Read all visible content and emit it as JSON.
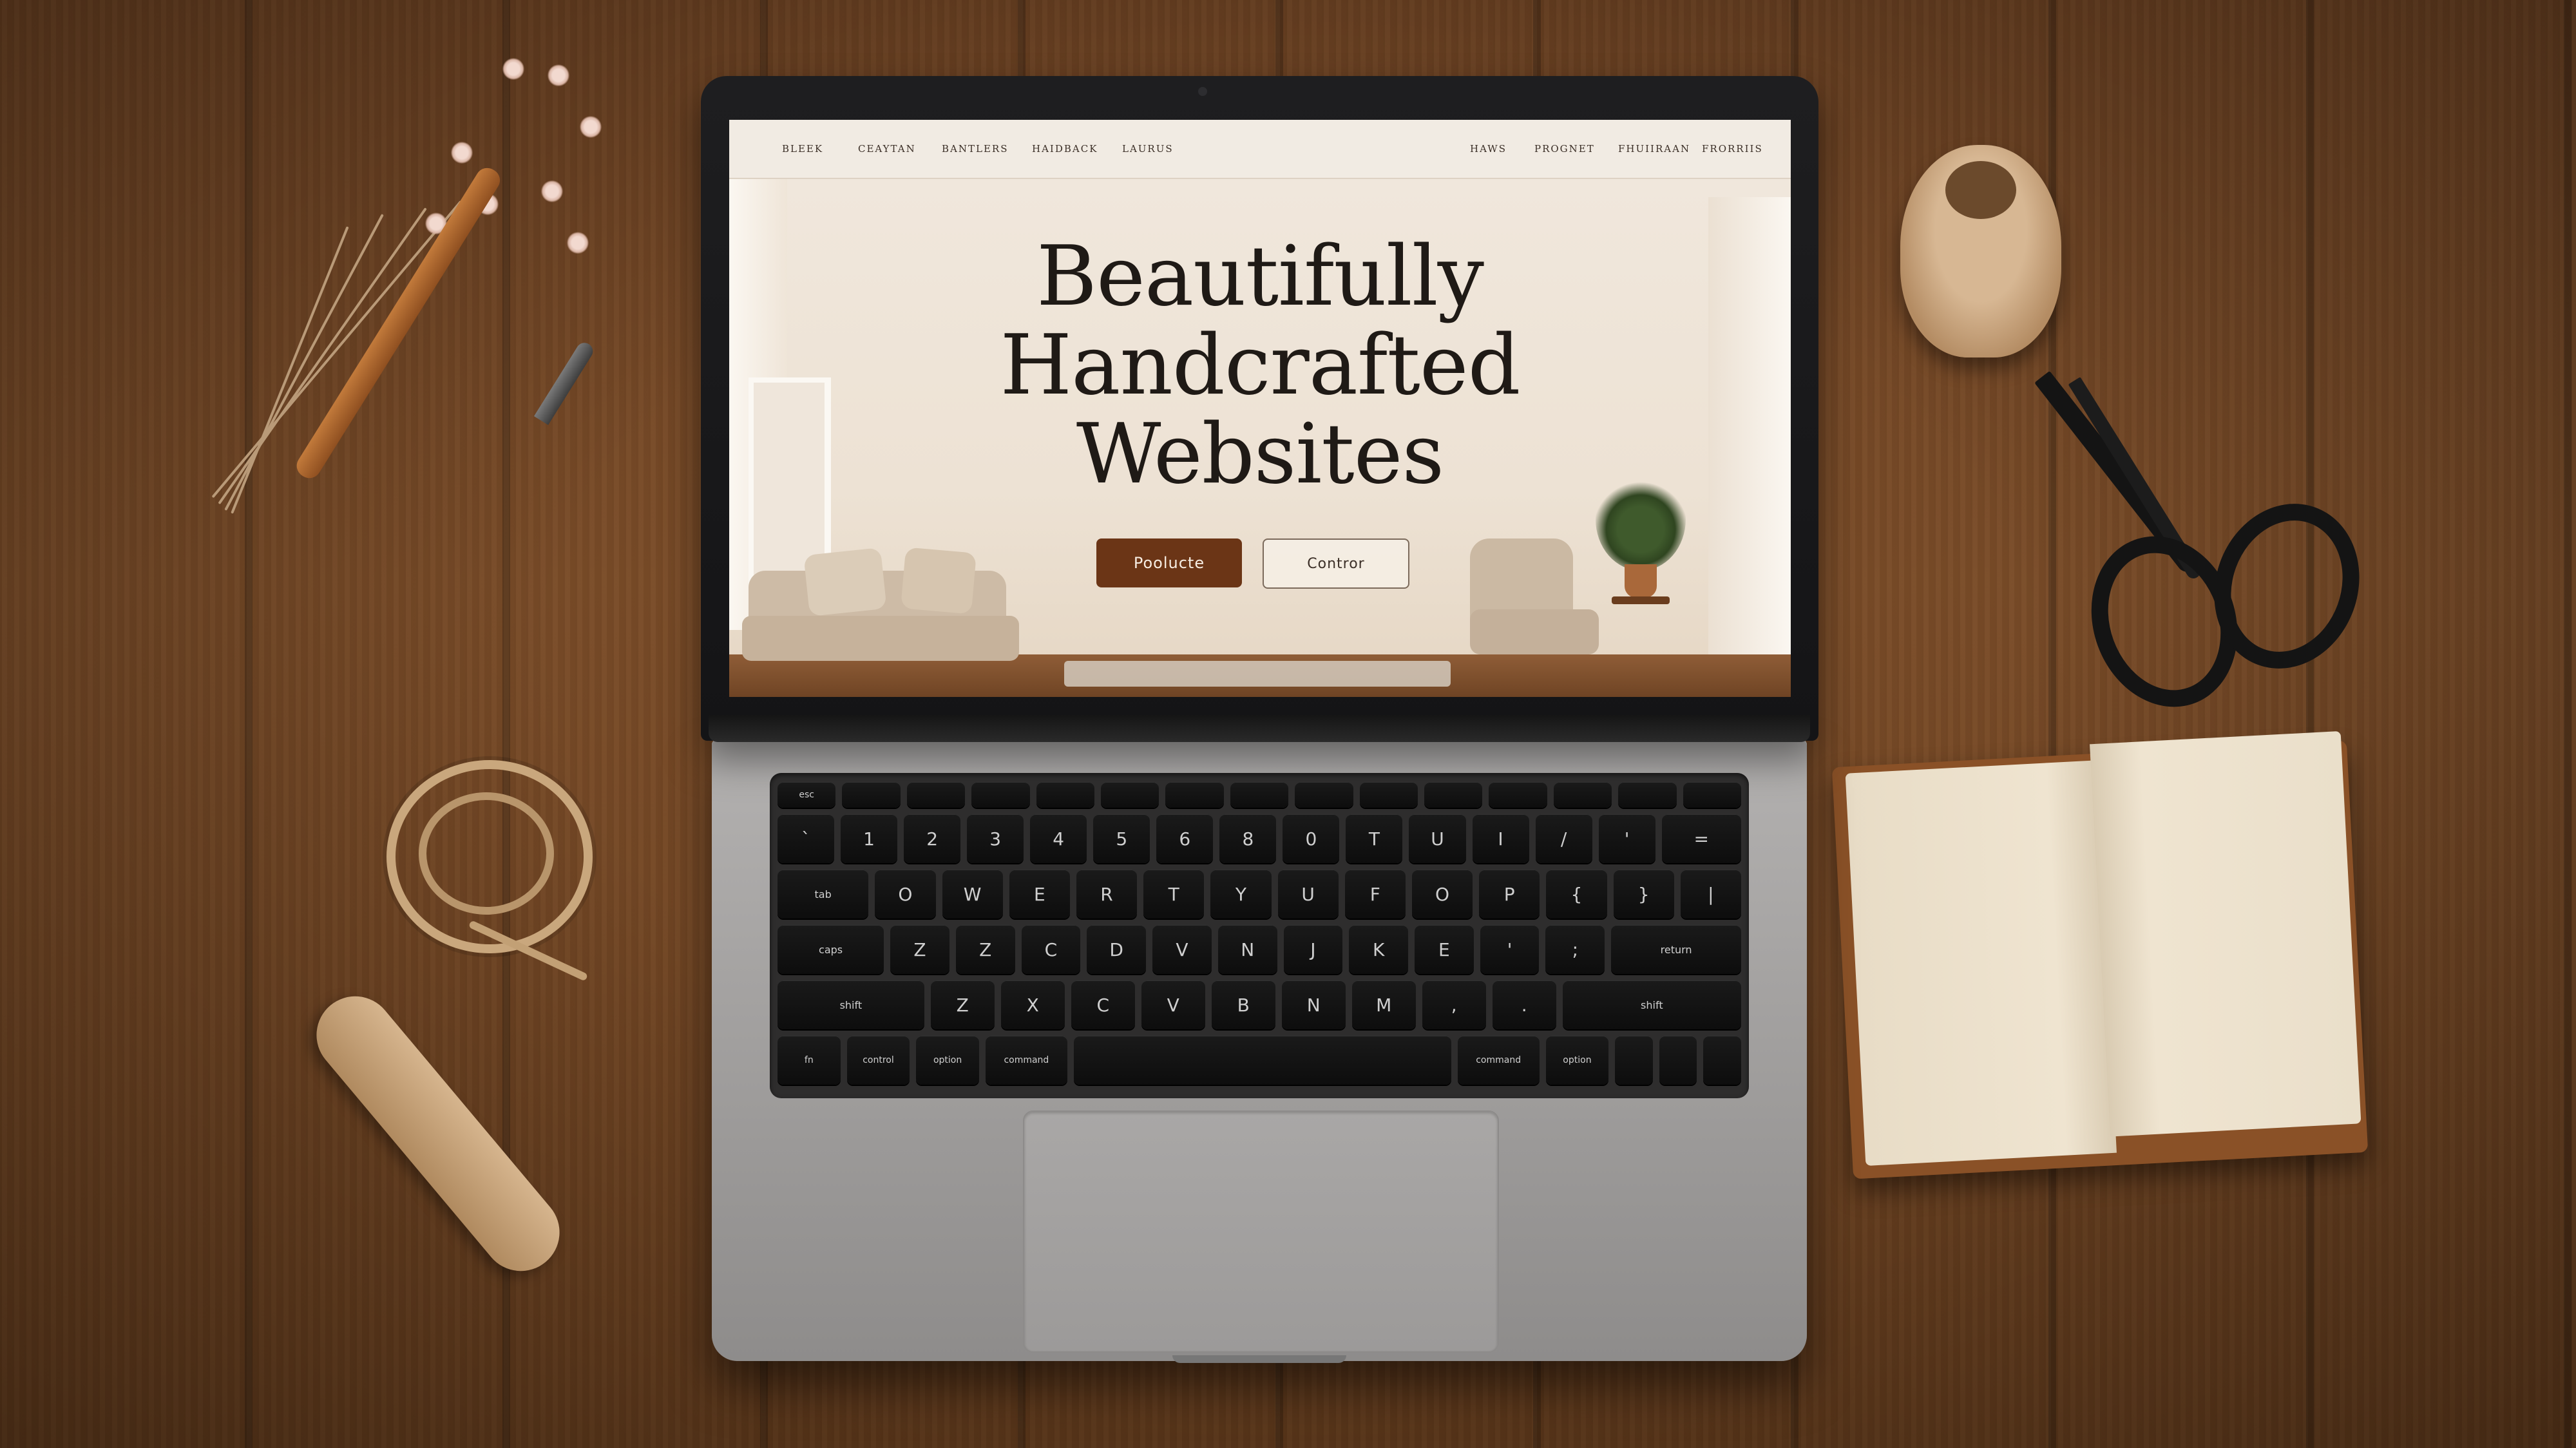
{
  "website": {
    "nav_left": [
      "BLEEK",
      "CEAYTAN",
      "BANTLERS",
      "HAIDBACK",
      "LAURUS"
    ],
    "nav_right": [
      "HAWS",
      "PROGNET",
      "FHUIIRAAN",
      "FRORRIIS"
    ],
    "hero_title_lines": [
      "Beautifully",
      "Handcrafted",
      "Websites"
    ],
    "primary_button": "Poolucte",
    "secondary_button": "Contror"
  },
  "keyboard": {
    "fn_row": [
      "esc",
      "",
      "",
      "",
      "",
      "",
      "",
      "",
      "",
      "",
      "",
      "",
      "",
      "",
      ""
    ],
    "row1": [
      "`",
      "1",
      "2",
      "3",
      "4",
      "5",
      "6",
      "8",
      "0",
      "T",
      "U",
      "I",
      "/",
      "'",
      "="
    ],
    "row2": [
      "tab",
      "O",
      "W",
      "E",
      "R",
      "T",
      "Y",
      "U",
      "F",
      "O",
      "P",
      "{",
      "}",
      "|"
    ],
    "row3": [
      "caps",
      "Z",
      "Z",
      "C",
      "D",
      "V",
      "N",
      "J",
      "K",
      "E",
      "'",
      ";",
      "return"
    ],
    "row4": [
      "shift",
      "Z",
      "X",
      "C",
      "V",
      "B",
      "N",
      "M",
      ",",
      ".",
      "shift"
    ],
    "row5": [
      "fn",
      "control",
      "option",
      "command",
      "",
      "command",
      "option",
      "",
      "",
      ""
    ]
  },
  "colors": {
    "primary_button": "#6b3516",
    "desk_wood": "#6e4323",
    "laptop_silver": "#a9a7a6"
  }
}
